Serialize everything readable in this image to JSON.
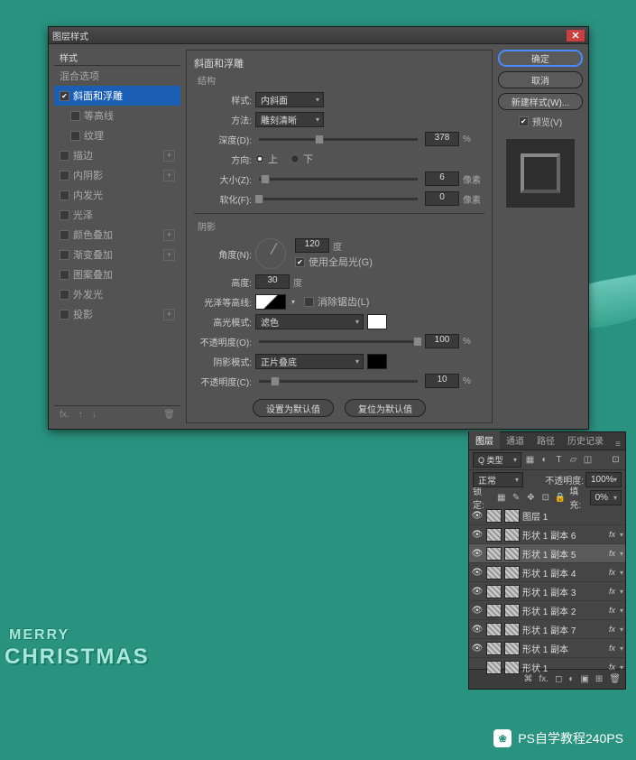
{
  "dialog": {
    "title": "图层样式",
    "ok": "确定",
    "cancel": "取消",
    "newStyle": "新建样式(W)...",
    "preview": "预览(V)",
    "stylesHeader": "样式",
    "list": {
      "blend": "混合选项",
      "bevel": "斜面和浮雕",
      "contour": "等高线",
      "texture": "纹理",
      "stroke": "描边",
      "innerShadow": "内阴影",
      "innerGlow": "内发光",
      "satin": "光泽",
      "colorOverlay": "颜色叠加",
      "gradOverlay": "渐变叠加",
      "patternOverlay": "图案叠加",
      "outerGlow": "外发光",
      "dropShadow": "投影"
    },
    "footer": {
      "fx": "fx.",
      "up": "↑",
      "down": "↓",
      "trash": "🗑"
    },
    "panelTitle": "斜面和浮雕",
    "structureTitle": "结构",
    "style": {
      "label": "样式:",
      "value": "内斜面"
    },
    "technique": {
      "label": "方法:",
      "value": "雕刻清晰"
    },
    "depth": {
      "label": "深度(D):",
      "value": "378",
      "unit": "%"
    },
    "direction": {
      "label": "方向:",
      "up": "上",
      "down": "下"
    },
    "size": {
      "label": "大小(Z):",
      "value": "6",
      "unit": "像素"
    },
    "soften": {
      "label": "软化(F):",
      "value": "0",
      "unit": "像素"
    },
    "shadingTitle": "阴影",
    "angle": {
      "label": "角度(N):",
      "value": "120",
      "unit": "度"
    },
    "globalLight": "使用全局光(G)",
    "altitude": {
      "label": "高度:",
      "value": "30",
      "unit": "度"
    },
    "glossContour": {
      "label": "光泽等高线:",
      "antialias": "消除锯齿(L)"
    },
    "highlightMode": {
      "label": "高光模式:",
      "value": "滤色"
    },
    "highlightOpacity": {
      "label": "不透明度(O):",
      "value": "100",
      "unit": "%"
    },
    "shadowMode": {
      "label": "阴影模式:",
      "value": "正片叠底"
    },
    "shadowOpacity": {
      "label": "不透明度(C):",
      "value": "10",
      "unit": "%"
    },
    "setDefault": "设置为默认值",
    "resetDefault": "复位为默认值"
  },
  "artwork": {
    "merry": "MERRY",
    "christmas": "CHRISTMAS"
  },
  "layers": {
    "tabs": {
      "layers": "图层",
      "channels": "通道",
      "paths": "路径",
      "history": "历史记录"
    },
    "kind": "Q 类型",
    "blendMode": "正常",
    "opacityLabel": "不透明度:",
    "opacityValue": "100%",
    "lockLabel": "锁定:",
    "fillLabel": "填充:",
    "fillValue": "0%",
    "items": [
      {
        "name": "图层 1",
        "fx": false,
        "eye": true,
        "sel": false
      },
      {
        "name": "形状 1 副本 6",
        "fx": true,
        "eye": true,
        "sel": false
      },
      {
        "name": "形状 1 副本 5",
        "fx": true,
        "eye": true,
        "sel": true
      },
      {
        "name": "形状 1 副本 4",
        "fx": true,
        "eye": true,
        "sel": false
      },
      {
        "name": "形状 1 副本 3",
        "fx": true,
        "eye": true,
        "sel": false
      },
      {
        "name": "形状 1 副本 2",
        "fx": true,
        "eye": true,
        "sel": false
      },
      {
        "name": "形状 1 副本 7",
        "fx": true,
        "eye": true,
        "sel": false
      },
      {
        "name": "形状 1 副本",
        "fx": true,
        "eye": true,
        "sel": false
      },
      {
        "name": "形状 1",
        "fx": true,
        "eye": false,
        "sel": false
      }
    ]
  },
  "credit": "PS自学教程240PS"
}
